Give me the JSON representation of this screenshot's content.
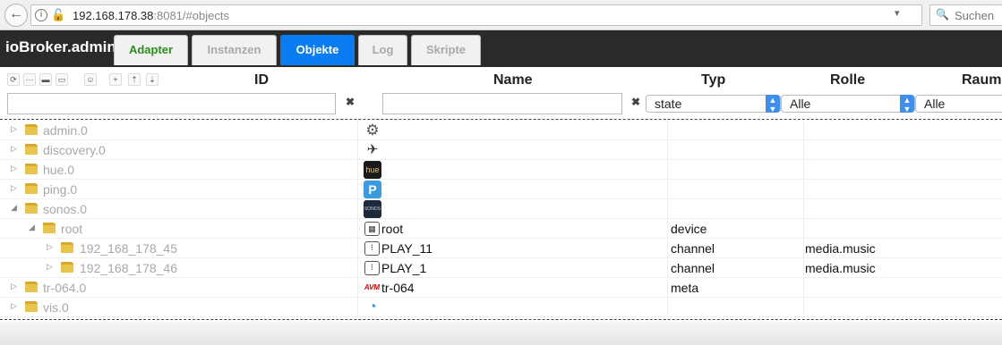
{
  "browser": {
    "url_host": "192.168.178.38",
    "url_rest": ":8081/#objects",
    "search_placeholder": "Suchen"
  },
  "app": {
    "title": "ioBroker.admin",
    "tabs": [
      {
        "label": "Adapter"
      },
      {
        "label": "Instanzen"
      },
      {
        "label": "Objekte"
      },
      {
        "label": "Log"
      },
      {
        "label": "Skripte"
      }
    ]
  },
  "columns": {
    "id": "ID",
    "name": "Name",
    "type": "Typ",
    "role": "Rolle",
    "room": "Raum"
  },
  "filters": {
    "type_value": "state",
    "role_value": "Alle",
    "room_value": "Alle",
    "clear": "✖"
  },
  "rows": [
    {
      "id": "admin.0",
      "icon": "gear-icon",
      "name": "",
      "type": "",
      "role": ""
    },
    {
      "id": "discovery.0",
      "icon": "binoculars-icon",
      "name": "",
      "type": "",
      "role": ""
    },
    {
      "id": "hue.0",
      "icon": "hue-icon",
      "name": "",
      "type": "",
      "role": ""
    },
    {
      "id": "ping.0",
      "icon": "ping-icon",
      "name": "",
      "type": "",
      "role": ""
    },
    {
      "id": "sonos.0",
      "icon": "sonos-icon",
      "name": "",
      "type": "",
      "role": ""
    },
    {
      "id": "root",
      "icon": "device-icon",
      "name": "root",
      "type": "device",
      "role": ""
    },
    {
      "id": "192_168_178_45",
      "icon": "channel-icon",
      "name": "PLAY_11",
      "type": "channel",
      "role": "media.music"
    },
    {
      "id": "192_168_178_46",
      "icon": "channel-icon",
      "name": "PLAY_1",
      "type": "channel",
      "role": "media.music"
    },
    {
      "id": "tr-064.0",
      "icon": "avm-icon",
      "name": "tr-064",
      "type": "meta",
      "role": ""
    },
    {
      "id": "vis.0",
      "icon": "vis-icon",
      "name": "",
      "type": "",
      "role": ""
    }
  ],
  "icon_glyphs": {
    "hue": "hue",
    "ping": "P",
    "sonos": "SONOS",
    "avm": "AVM"
  }
}
